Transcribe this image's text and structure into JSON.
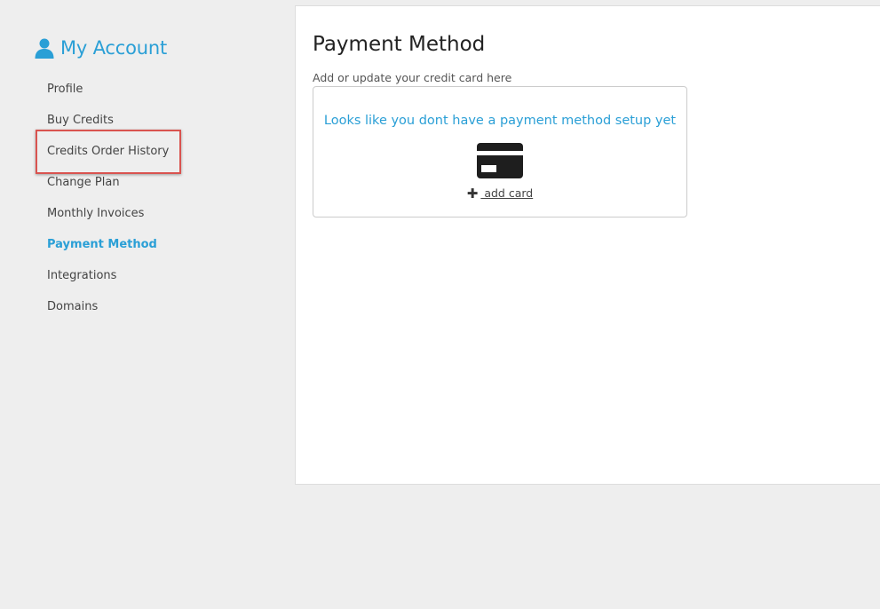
{
  "sidebar": {
    "title": "My Account",
    "title_icon": "user-icon",
    "items": [
      {
        "label": "Profile"
      },
      {
        "label": "Buy Credits"
      },
      {
        "label": "Credits Order History"
      },
      {
        "label": "Change Plan"
      },
      {
        "label": "Monthly Invoices"
      },
      {
        "label": "Payment Method",
        "active": true
      },
      {
        "label": "Integrations"
      },
      {
        "label": "Domains"
      }
    ],
    "highlighted_item": "Credits Order History",
    "highlight_color": "#d9534f"
  },
  "main": {
    "title": "Payment Method",
    "subtitle": "Add or update your credit card here",
    "empty_message": "Looks like you dont have a payment method setup yet",
    "card_icon": "credit-card-icon",
    "add_card": {
      "plus": "✚",
      "label": " add card"
    }
  },
  "colors": {
    "accent": "#2a9fd6",
    "background": "#eeeeee",
    "panel": "#ffffff",
    "text": "#444444"
  }
}
